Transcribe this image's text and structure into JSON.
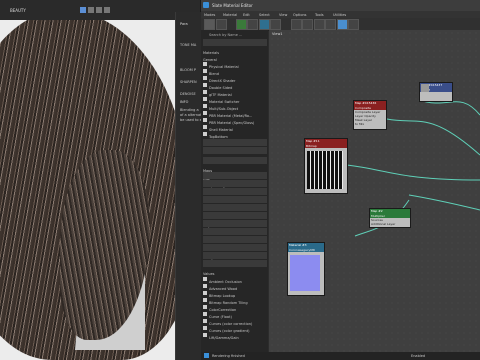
{
  "viewport": {
    "label": "BEAUTY"
  },
  "props_panel": {
    "tab": "Para",
    "sections": [
      "TONE MA",
      "BLOOM P",
      "SHARPEN",
      "DENOISE"
    ],
    "info_title": "INFO",
    "info_text": [
      "Blending a",
      "of a alternat",
      "be used to e"
    ]
  },
  "window": {
    "title": "Slate Material Editor"
  },
  "menu": [
    "Modes",
    "Material",
    "Edit",
    "Select",
    "View",
    "Options",
    "Tools",
    "Utilities"
  ],
  "view_tab": "View1",
  "browser": {
    "search_placeholder": "Search by Name ...",
    "section_materials": "Materials",
    "cat_general": "General",
    "general_items": [
      "Physical Material",
      "Blend",
      "DirectX Shader",
      "Double Sided",
      "glTF Material",
      "Material Switcher",
      "Multi/Sub-Object",
      "PBR Material (Metal/Ro...",
      "PBR Material (Spec/Gloss)",
      "Shell Material",
      "TopBottom",
      "Xref Material"
    ],
    "cat_scanline": "Scanline",
    "cat_corona": "Corona",
    "section_maps": "Maps",
    "cat_osl": "OSL",
    "osl_items": [
      "Compositing",
      "Environment",
      "Math Color",
      "Math Float",
      "Math Vector",
      "Projection",
      "Scene Attributes",
      "Switchers",
      "Textures",
      "Utility",
      "UVW Coordinates",
      "Values"
    ],
    "map_items": [
      "Ambient Occlusion",
      "Advanced Wood",
      "Bitmap Lookup",
      "Bitmap Random Tiling",
      "ColorCorrection",
      "Curve (Float)",
      "Curves (color correction)",
      "Curves (color gradient)",
      "Lift/Gamma/Gain"
    ]
  },
  "nodes": {
    "n1": {
      "title": "Map #415436",
      "sub": "Composite",
      "ports": [
        "Composite Layer",
        "Layer Opacity",
        "Mask Layer",
        "to Mix"
      ]
    },
    "n2": {
      "title": "Map #11",
      "sub": "Bitmap"
    },
    "n3": {
      "title": "Map #415437",
      "sub": "Falloff"
    },
    "n4": {
      "title": "Map #2",
      "sub": "Multiplier",
      "ports": [
        "Sources",
        "Additional Layer"
      ]
    },
    "n5": {
      "title": "Material #3",
      "sub": "CoronaLegacyMtl",
      "ports": [
        "Opacity",
        "Base"
      ]
    }
  },
  "status": {
    "text": "Rendering finished",
    "zoom": "Enabled"
  }
}
